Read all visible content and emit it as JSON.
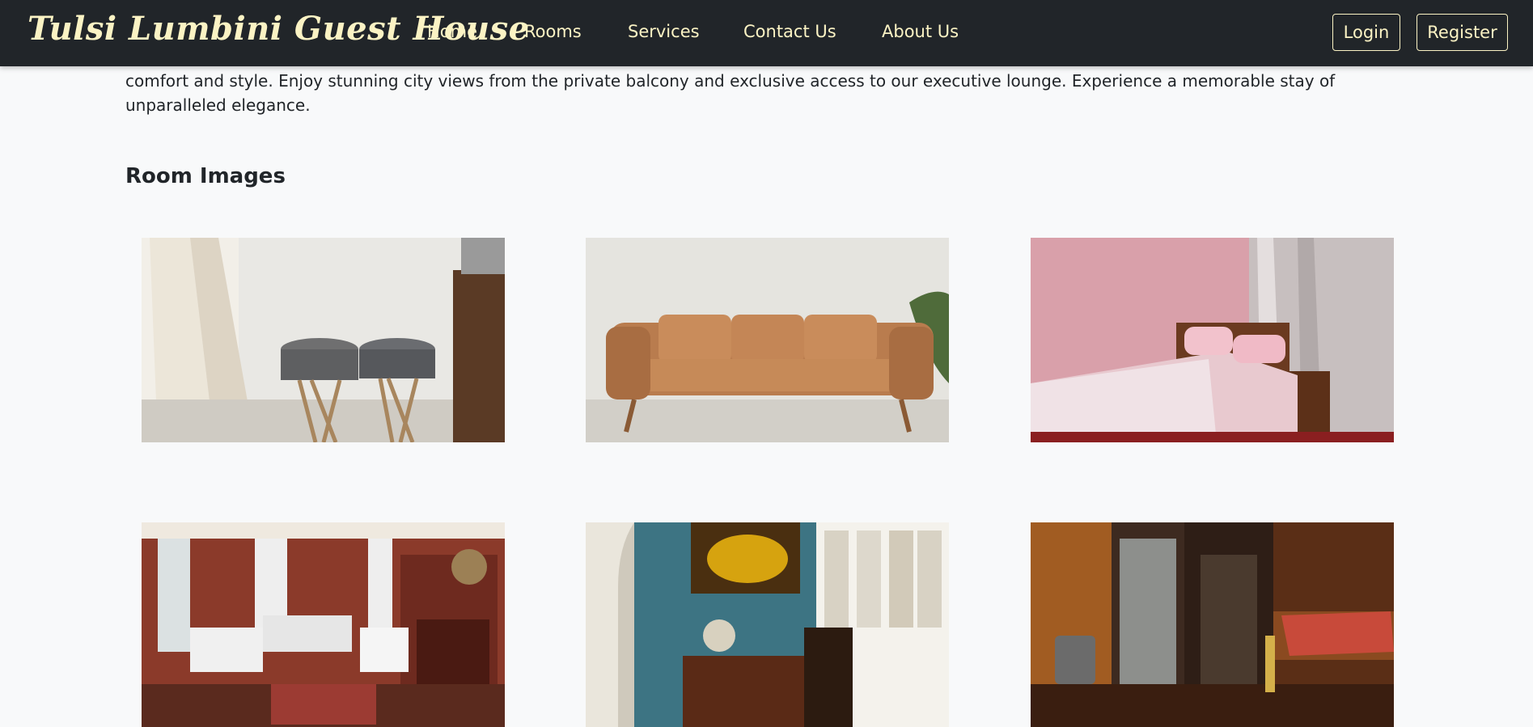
{
  "navbar": {
    "brand": "Tulsi Lumbini Guest House",
    "links": [
      "Home",
      "Rooms",
      "Services",
      "Contact Us",
      "About Us"
    ],
    "login_label": "Login",
    "register_label": "Register"
  },
  "main": {
    "description": "comfort and style. Enjoy stunning city views from the private balcony and exclusive access to our executive lounge. Experience a memorable stay of unparalleled elegance.",
    "room_images_title": "Room Images"
  },
  "colors": {
    "navbar_bg": "#212529",
    "brand_text": "#fbf3c4",
    "page_bg": "#f8f9fa"
  }
}
